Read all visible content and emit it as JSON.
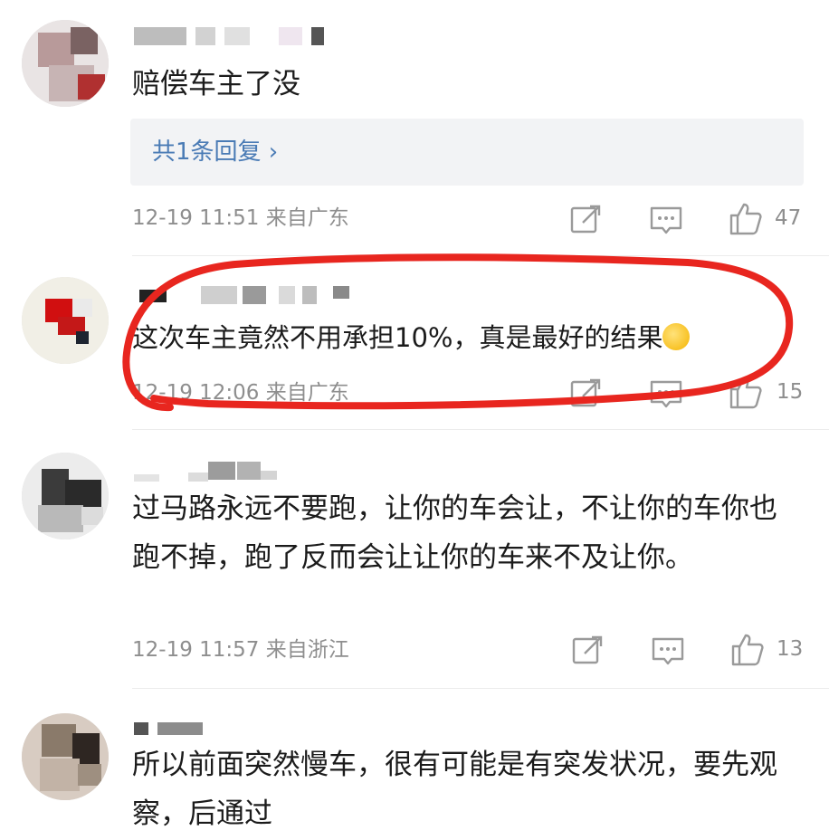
{
  "comments": [
    {
      "text": "赔偿车主了没",
      "reply_link": "共1条回复 ›",
      "meta": "12-19 11:51 来自广东",
      "likes": "47"
    },
    {
      "text": "这次车主竟然不用承担10%，真是最好的结果",
      "meta": "12-19 12:06 来自广东",
      "likes": "15",
      "highlighted": true,
      "highlight_color": "#e8261f"
    },
    {
      "text": "过马路永远不要跑，让你的车会让，不让你的车你也跑不掉，跑了反而会让让你的车来不及让你。",
      "meta": "12-19 11:57 来自浙江",
      "likes": "13"
    },
    {
      "text": "所以前面突然慢车，很有可能是有突发状况，要先观察，后通过"
    }
  ],
  "icons": {
    "share": "share-icon",
    "comment": "comment-icon",
    "like": "thumbs-up-icon"
  },
  "colors": {
    "link": "#4a7bb5",
    "meta": "#8e8e8e",
    "reply_bg": "#f2f3f5"
  }
}
